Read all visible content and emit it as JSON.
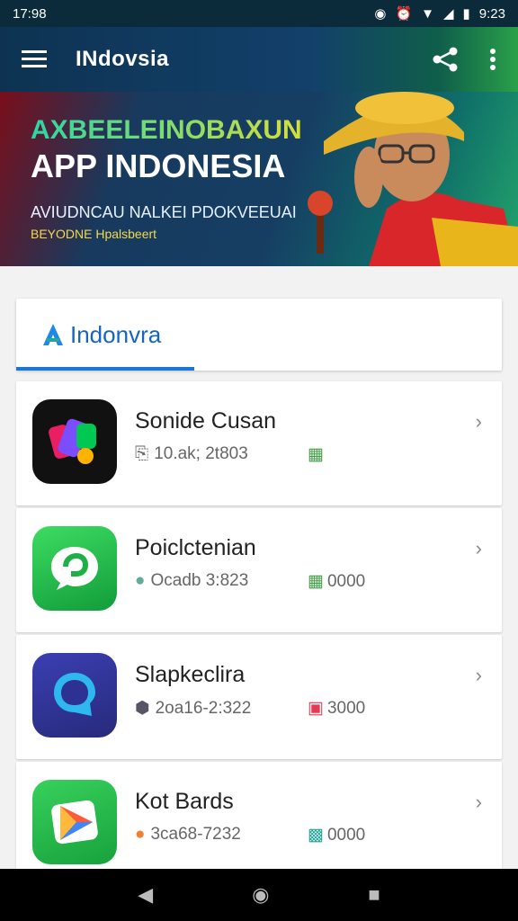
{
  "status_bar": {
    "time": "17:98",
    "right_time": "9:23"
  },
  "app_bar": {
    "title": "INdovsia"
  },
  "banner": {
    "headline_top": "AXBEELEINOBAXUN",
    "headline_main": "APP INDONESIA",
    "subtitle": "AVIUDNCAU NALKEI PDOKVEEUAI",
    "tagline": "BEYODNE Hpalsbeert"
  },
  "tabs": [
    {
      "label": "Indonvra",
      "icon": "logo-icon",
      "selected": true
    }
  ],
  "apps": [
    {
      "name": "Sonide Cusan",
      "meta": "10.ak; 2t803",
      "stat": "",
      "stat_icon": "qr-icon"
    },
    {
      "name": "Poiclctenian",
      "meta": "Ocadb 3:823",
      "stat": "0000",
      "stat_icon": "qr-icon"
    },
    {
      "name": "Slapkeclira",
      "meta": "2oa16-2:322",
      "stat": "3000",
      "stat_icon": "camera-icon"
    },
    {
      "name": "Kot Bards",
      "meta": "3ca68-7232",
      "stat": "0000",
      "stat_icon": "puzzle-icon"
    }
  ],
  "colors": {
    "accent": "#1976d2",
    "appbar": "#0e3352"
  }
}
